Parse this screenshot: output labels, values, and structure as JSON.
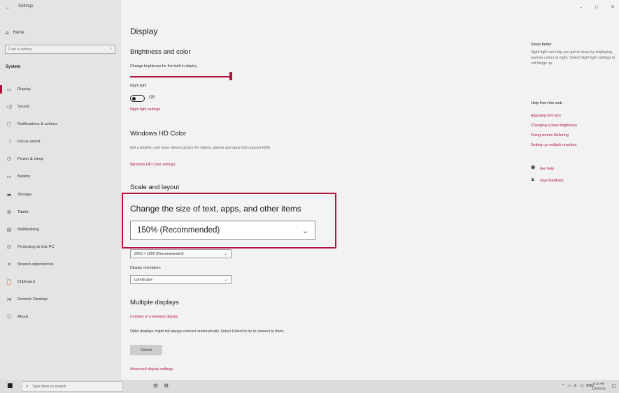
{
  "window": {
    "title": "Settings",
    "back_icon": "←",
    "controls": {
      "minimize": "–",
      "maximize": "▫",
      "close": "✕"
    }
  },
  "sidebar": {
    "home": {
      "icon": "⌂",
      "label": "Home"
    },
    "search": {
      "placeholder": "Find a setting",
      "icon": "⌕"
    },
    "section": "System",
    "items": [
      {
        "icon": "▭",
        "label": "Display",
        "active": true
      },
      {
        "icon": "◁)",
        "label": "Sound"
      },
      {
        "icon": "▢",
        "label": "Notifications & actions"
      },
      {
        "icon": "☽",
        "label": "Focus assist"
      },
      {
        "icon": "⏻",
        "label": "Power & sleep"
      },
      {
        "icon": "▭",
        "label": "Battery"
      },
      {
        "icon": "▬",
        "label": "Storage"
      },
      {
        "icon": "⧉",
        "label": "Tablet"
      },
      {
        "icon": "▤",
        "label": "Multitasking"
      },
      {
        "icon": "⊡",
        "label": "Projecting to this PC"
      },
      {
        "icon": "✕",
        "label": "Shared experiences"
      },
      {
        "icon": "📋",
        "label": "Clipboard"
      },
      {
        "icon": "⋊",
        "label": "Remote Desktop"
      },
      {
        "icon": "ⓘ",
        "label": "About"
      }
    ]
  },
  "main": {
    "title": "Display",
    "brightness": {
      "heading": "Brightness and color",
      "slider_label": "Change brightness for the built-in display",
      "night_light_label": "Night light",
      "night_light_state": "Off",
      "night_light_link": "Night light settings"
    },
    "hdr": {
      "heading": "Windows HD Color",
      "description": "Get a brighter and more vibrant picture for videos, games and apps that support HDR.",
      "link": "Windows HD Color settings"
    },
    "scale": {
      "heading": "Scale and layout",
      "callout_label": "Change the size of text, apps, and other items",
      "callout_value": "150% (Recommended)",
      "resolution_value": "2560 × 1600 (Recommended)",
      "orientation_label": "Display orientation",
      "orientation_value": "Landscape"
    },
    "multiple": {
      "heading": "Multiple displays",
      "link": "Connect to a wireless display",
      "description": "Older displays might not always connect automatically. Select Detect to try to connect to them.",
      "detect_button": "Detect",
      "advanced_link": "Advanced display settings"
    }
  },
  "right": {
    "sleep_heading": "Sleep better",
    "sleep_text": "Night light can help you get to sleep by displaying warmer colors at night. Select Night light settings to set things up.",
    "help_heading": "Help from the web",
    "help_links": [
      "Adjusting font size",
      "Changing screen brightness",
      "Fixing screen flickering",
      "Setting up multiple monitors"
    ],
    "get_help": "Get help",
    "give_feedback": "Give feedback"
  },
  "taskbar": {
    "search_placeholder": "Type here to search",
    "language": "ENG",
    "time": "8:14 AM",
    "date": "1/20/2021"
  },
  "colors": {
    "accent": "#b0163c",
    "sidebar_bg": "#e4e4e4",
    "content_bg": "#f2f2f2"
  }
}
